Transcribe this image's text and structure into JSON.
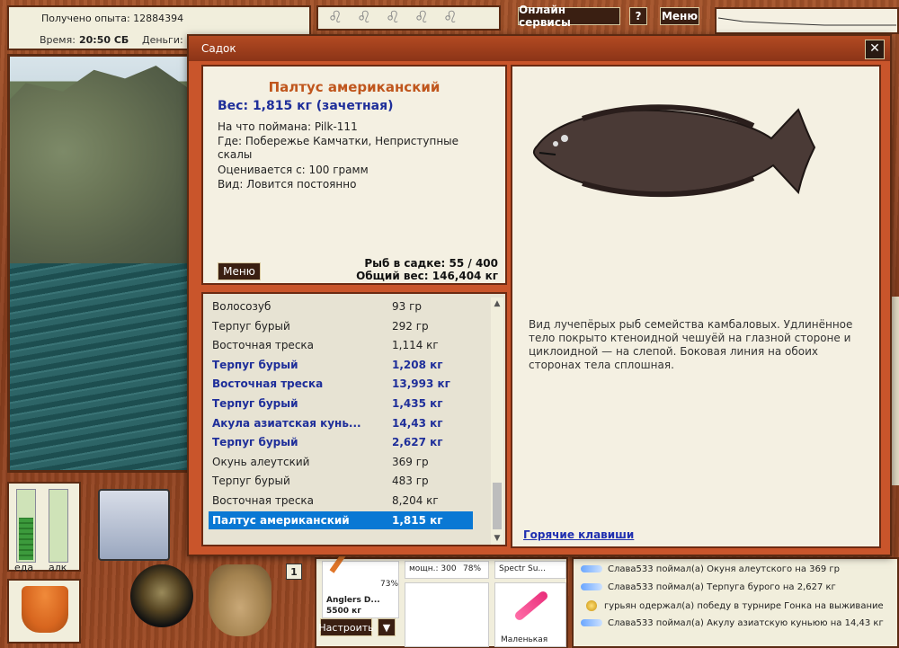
{
  "hud": {
    "experience": "Получено опыта: 12884394",
    "time_label": "Время:",
    "time_value": "20:50 СБ",
    "money_label": "Деньги:",
    "online_services": "Онлайн сервисы",
    "help": "?",
    "menu": "Меню"
  },
  "meters": [
    {
      "label": "еда",
      "level": 0.62
    },
    {
      "label": "алк",
      "level": 0.0
    }
  ],
  "badge": "1",
  "dialog": {
    "title": "Садок",
    "close": "✕",
    "fish": {
      "name": "Палтус американский",
      "weight": "Вес: 1,815 кг (зачетная)",
      "caught_with": "На что поймана: Pilk-111",
      "where": "Где: Побережье Камчатки, Неприступные скалы",
      "rated_from": "Оценивается с: 100 грамм",
      "kind": "Вид: Ловится постоянно",
      "description": "Вид лучепёрых рыб семейства камбаловых. Удлинённое тело покрыто ктеноидной чешуёй на глазной стороне и циклоидной — на слепой. Боковая линия на обоих сторонах тела сплошная."
    },
    "menu_button": "Меню",
    "fish_in_keep": "Рыб в садке: 55 / 400",
    "total_weight": "Общий вес: 146,404 кг",
    "hotkeys": "Горячие клавиши",
    "list": [
      {
        "name": "Волосозуб",
        "weight": "93 гр",
        "style": "normal"
      },
      {
        "name": "Терпуг бурый",
        "weight": "292 гр",
        "style": "normal"
      },
      {
        "name": "Восточная треска",
        "weight": "1,114 кг",
        "style": "normal"
      },
      {
        "name": "Терпуг бурый",
        "weight": "1,208 кг",
        "style": "bold"
      },
      {
        "name": "Восточная треска",
        "weight": "13,993 кг",
        "style": "bold"
      },
      {
        "name": "Терпуг бурый",
        "weight": "1,435 кг",
        "style": "bold"
      },
      {
        "name": "Акула азиатская кунь...",
        "weight": "14,43 кг",
        "style": "bold"
      },
      {
        "name": "Терпуг бурый",
        "weight": "2,627 кг",
        "style": "bold"
      },
      {
        "name": "Окунь алеутский",
        "weight": "369 гр",
        "style": "normal"
      },
      {
        "name": "Терпуг бурый",
        "weight": "483 гр",
        "style": "normal"
      },
      {
        "name": "Восточная треска",
        "weight": "8,204 кг",
        "style": "normal"
      },
      {
        "name": "Палтус американский",
        "weight": "1,815 кг",
        "style": "selected"
      }
    ]
  },
  "equipment": {
    "rod_name": "Anglers D...",
    "rod_load": "5500 кг",
    "percent_1": "73%",
    "power": "мощн.: 300",
    "percent_2": "78%",
    "lure": "Spectr Su...",
    "small": "Маленькая",
    "setup": "Настроить",
    "arrow": "▼"
  },
  "chat": [
    {
      "text": "Слава533 поймал(а) Окуня алеутского на 369 гр",
      "icon": "fish"
    },
    {
      "text": "Слава533 поймал(а) Терпуга бурого на 2,627 кг",
      "icon": "fish"
    },
    {
      "text": "гурьян одержал(а) победу в турнире Гонка на выживание",
      "icon": "medal"
    },
    {
      "text": "Слава533 поймал(а) Акулу азиатскую куньюю на 14,43 кг",
      "icon": "fish"
    }
  ],
  "colors": {
    "accent_name": "#c0561d",
    "weight_blue": "#1f2f9a",
    "selection": "#0a78d4"
  }
}
